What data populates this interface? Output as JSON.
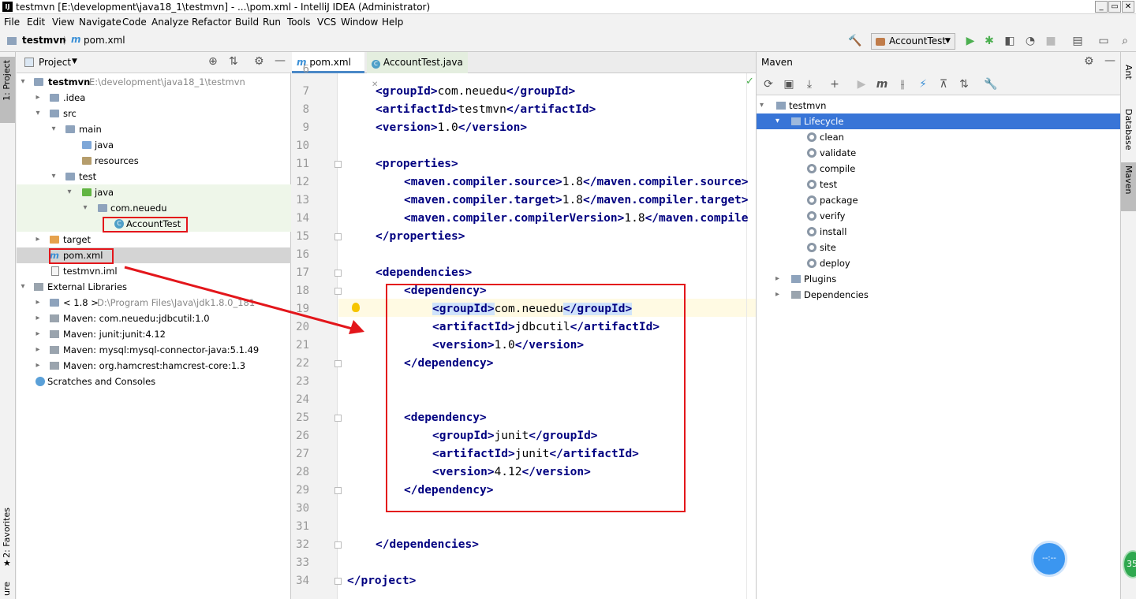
{
  "window": {
    "title": "testmvn [E:\\development\\java18_1\\testmvn] - ...\\pom.xml - IntelliJ IDEA (Administrator)",
    "controls": [
      "_",
      "▭",
      "✕"
    ]
  },
  "menu": [
    "File",
    "Edit",
    "View",
    "Navigate",
    "Code",
    "Analyze",
    "Refactor",
    "Build",
    "Run",
    "Tools",
    "VCS",
    "Window",
    "Help"
  ],
  "breadcrumb": {
    "project": "testmvn",
    "file": "pom.xml"
  },
  "run_config": "AccountTest",
  "left_tabs": {
    "project": "1: Project",
    "favorites": "2: Favorites",
    "structure": "ure"
  },
  "right_tabs": {
    "ant": "Ant",
    "database": "Database",
    "maven": "Maven"
  },
  "project_panel": {
    "title": "Project",
    "tree": [
      {
        "label": "testmvn",
        "extra": "E:\\development\\java18_1\\testmvn",
        "bold": true,
        "icon": "module-icon"
      },
      {
        "label": ".idea",
        "icon": "folder-icon"
      },
      {
        "label": "src",
        "icon": "folder-icon"
      },
      {
        "label": "main",
        "icon": "folder-icon"
      },
      {
        "label": "java",
        "icon": "source-folder-icon"
      },
      {
        "label": "resources",
        "icon": "resources-folder-icon"
      },
      {
        "label": "test",
        "icon": "folder-icon"
      },
      {
        "label": "java",
        "icon": "test-folder-icon"
      },
      {
        "label": "com.neuedu",
        "icon": "package-icon"
      },
      {
        "label": "AccountTest",
        "icon": "class-icon"
      },
      {
        "label": "target",
        "icon": "excluded-folder-icon"
      },
      {
        "label": "pom.xml",
        "icon": "maven-file-icon"
      },
      {
        "label": "testmvn.iml",
        "icon": "iml-file-icon"
      },
      {
        "label": "External Libraries",
        "icon": "library-icon"
      },
      {
        "label": "< 1.8 >",
        "extra": "D:\\Program Files\\Java\\jdk1.8.0_181",
        "icon": "jdk-icon"
      },
      {
        "label": "Maven: com.neuedu:jdbcutil:1.0",
        "icon": "library-icon"
      },
      {
        "label": "Maven: junit:junit:4.12",
        "icon": "library-icon"
      },
      {
        "label": "Maven: mysql:mysql-connector-java:5.1.49",
        "icon": "library-icon"
      },
      {
        "label": "Maven: org.hamcrest:hamcrest-core:1.3",
        "icon": "library-icon"
      },
      {
        "label": "Scratches and Consoles",
        "icon": "scratches-icon"
      }
    ]
  },
  "editor": {
    "tabs": [
      "pom.xml",
      "AccountTest.java"
    ],
    "first_line": "6",
    "lines": [
      {
        "n": "7",
        "parts": [
          [
            "tag",
            "<groupId>"
          ],
          [
            "txt",
            "com.neuedu"
          ],
          [
            "tag",
            "</groupId>"
          ]
        ]
      },
      {
        "n": "8",
        "parts": [
          [
            "tag",
            "<artifactId>"
          ],
          [
            "txt",
            "testmvn"
          ],
          [
            "tag",
            "</artifactId>"
          ]
        ]
      },
      {
        "n": "9",
        "parts": [
          [
            "tag",
            "<version>"
          ],
          [
            "txt",
            "1.0"
          ],
          [
            "tag",
            "</version>"
          ]
        ]
      },
      {
        "n": "10",
        "parts": []
      },
      {
        "n": "11",
        "parts": [
          [
            "tag",
            "<properties>"
          ]
        ]
      },
      {
        "n": "12",
        "parts": [
          [
            "tag",
            "<maven.compiler.source>"
          ],
          [
            "txt",
            "1.8"
          ],
          [
            "tag",
            "</maven.compiler.source>"
          ]
        ]
      },
      {
        "n": "13",
        "parts": [
          [
            "tag",
            "<maven.compiler.target>"
          ],
          [
            "txt",
            "1.8"
          ],
          [
            "tag",
            "</maven.compiler.target>"
          ]
        ]
      },
      {
        "n": "14",
        "parts": [
          [
            "tag",
            "<maven.compiler.compilerVersion>"
          ],
          [
            "txt",
            "1.8"
          ],
          [
            "tag",
            "</maven.compile"
          ]
        ]
      },
      {
        "n": "15",
        "parts": [
          [
            "tag",
            "</properties>"
          ]
        ]
      },
      {
        "n": "16",
        "parts": []
      },
      {
        "n": "17",
        "parts": [
          [
            "tag",
            "<dependencies>"
          ]
        ]
      },
      {
        "n": "18",
        "parts": [
          [
            "tag",
            "<dependency>"
          ]
        ]
      },
      {
        "n": "19",
        "parts": [
          [
            "hltag",
            "<groupId>"
          ],
          [
            "txt",
            "com.neuedu"
          ],
          [
            "hltag",
            "</groupId>"
          ]
        ]
      },
      {
        "n": "20",
        "parts": [
          [
            "tag",
            "<artifactId>"
          ],
          [
            "txt",
            "jdbcutil"
          ],
          [
            "tag",
            "</artifactId>"
          ]
        ]
      },
      {
        "n": "21",
        "parts": [
          [
            "tag",
            "<version>"
          ],
          [
            "txt",
            "1.0"
          ],
          [
            "tag",
            "</version>"
          ]
        ]
      },
      {
        "n": "22",
        "parts": [
          [
            "tag",
            "</dependency>"
          ]
        ]
      },
      {
        "n": "23",
        "parts": []
      },
      {
        "n": "24",
        "parts": []
      },
      {
        "n": "25",
        "parts": [
          [
            "tag",
            "<dependency>"
          ]
        ]
      },
      {
        "n": "26",
        "parts": [
          [
            "tag",
            "<groupId>"
          ],
          [
            "txt",
            "junit"
          ],
          [
            "tag",
            "</groupId>"
          ]
        ]
      },
      {
        "n": "27",
        "parts": [
          [
            "tag",
            "<artifactId>"
          ],
          [
            "txt",
            "junit"
          ],
          [
            "tag",
            "</artifactId>"
          ]
        ]
      },
      {
        "n": "28",
        "parts": [
          [
            "tag",
            "<version>"
          ],
          [
            "txt",
            "4.12"
          ],
          [
            "tag",
            "</version>"
          ]
        ]
      },
      {
        "n": "29",
        "parts": [
          [
            "tag",
            "</dependency>"
          ]
        ]
      },
      {
        "n": "30",
        "parts": []
      },
      {
        "n": "31",
        "parts": []
      },
      {
        "n": "32",
        "parts": [
          [
            "tag",
            "</dependencies>"
          ]
        ]
      },
      {
        "n": "33",
        "parts": []
      },
      {
        "n": "34",
        "parts": [
          [
            "tag",
            "</project>"
          ]
        ]
      }
    ]
  },
  "maven_panel": {
    "title": "Maven",
    "project": "testmvn",
    "lifecycle": "Lifecycle",
    "goals": [
      "clean",
      "validate",
      "compile",
      "test",
      "package",
      "verify",
      "install",
      "site",
      "deploy"
    ],
    "plugins": "Plugins",
    "dependencies": "Dependencies"
  },
  "floating": {
    "badge": "35"
  },
  "colors": {
    "tag": "#000080",
    "selection": "#3875d7",
    "highlight_box": "#e3161b",
    "current_line": "#fffae3"
  }
}
